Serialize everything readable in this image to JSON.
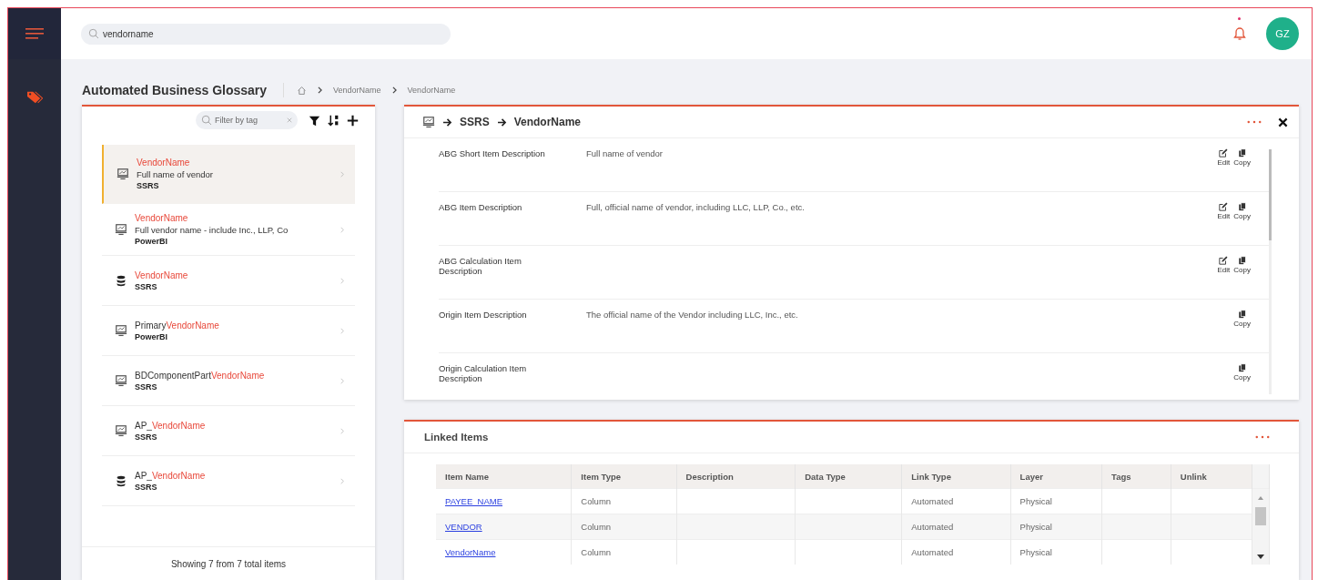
{
  "search": {
    "value": "vendorname"
  },
  "notifications": {
    "unread": true
  },
  "avatar": {
    "initials": "GZ"
  },
  "page": {
    "title": "Automated Business Glossary",
    "breadcrumb": [
      "VendorName",
      "VendorName"
    ]
  },
  "list": {
    "filter_placeholder": "Filter by tag",
    "footer": "Showing 7 from 7 total items",
    "items": [
      {
        "kind": "report",
        "match": "VendorName",
        "description": "Full name of vendor",
        "source": "SSRS",
        "selected": true
      },
      {
        "kind": "report",
        "match": "VendorName",
        "description": "Full vendor name - include Inc., LLP, Co",
        "source": "PowerBI",
        "selected": false
      },
      {
        "kind": "database",
        "match": "VendorName",
        "source": "SSRS",
        "selected": false
      },
      {
        "kind": "report",
        "prefix": "Primary",
        "match": "VendorName",
        "source": "PowerBI",
        "selected": false
      },
      {
        "kind": "report",
        "prefix": "BDComponentPart",
        "match": "VendorName",
        "source": "SSRS",
        "selected": false
      },
      {
        "kind": "report",
        "prefix": "AP_",
        "match": "VendorName",
        "source": "SSRS",
        "selected": false
      },
      {
        "kind": "database",
        "prefix": "AP_",
        "match": "VendorName",
        "source": "SSRS",
        "selected": false
      }
    ]
  },
  "detail": {
    "path": [
      "SSRS",
      "VendorName"
    ],
    "rows": [
      {
        "label": "ABG Short Item Description",
        "value": "Full name of vendor",
        "actions": [
          {
            "kind": "edit",
            "label": "Edit"
          },
          {
            "kind": "copy",
            "label": "Copy"
          }
        ]
      },
      {
        "label": "ABG Item Description",
        "value": "Full, official name of vendor, including LLC, LLP, Co., etc.",
        "actions": [
          {
            "kind": "edit",
            "label": "Edit"
          },
          {
            "kind": "copy",
            "label": "Copy"
          }
        ]
      },
      {
        "label": "ABG Calculation Item Description",
        "actions": [
          {
            "kind": "edit",
            "label": "Edit"
          },
          {
            "kind": "copy",
            "label": "Copy"
          }
        ]
      },
      {
        "label": "Origin Item Description",
        "value": "The official name of the Vendor including LLC, Inc., etc.",
        "actions": [
          {
            "kind": "copy",
            "label": "Copy"
          }
        ]
      },
      {
        "label": "Origin Calculation Item Description",
        "actions": [
          {
            "kind": "copy",
            "label": "Copy"
          }
        ]
      }
    ]
  },
  "linked": {
    "title": "Linked Items",
    "columns": [
      "Item Name",
      "Item Type",
      "Description",
      "Data Type",
      "Link Type",
      "Layer",
      "Tags",
      "Unlink"
    ],
    "rows": [
      {
        "item_name": "PAYEE_NAME",
        "item_type": "Column",
        "link_type": "Automated",
        "layer": "Physical"
      },
      {
        "item_name": "VENDOR",
        "item_type": "Column",
        "link_type": "Automated",
        "layer": "Physical"
      },
      {
        "item_name": "VendorName",
        "item_type": "Column",
        "link_type": "Automated",
        "layer": "Physical"
      }
    ]
  }
}
